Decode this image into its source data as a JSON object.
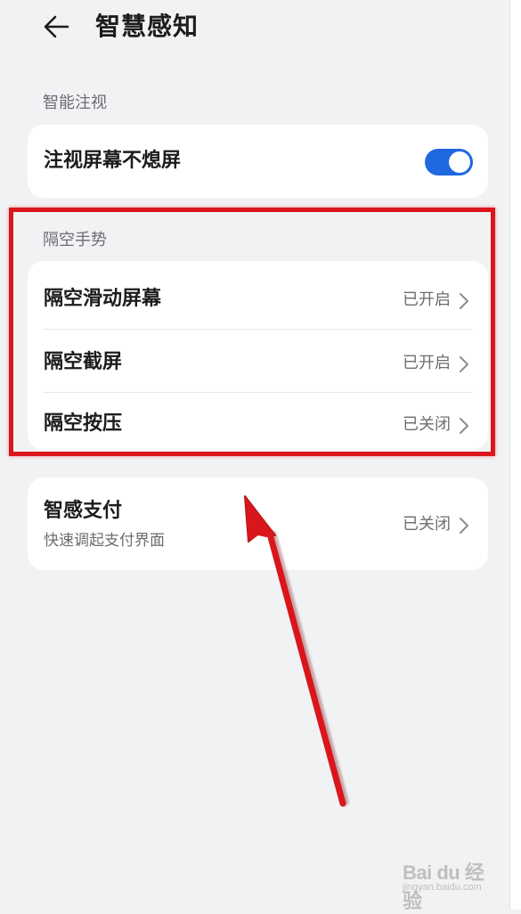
{
  "header": {
    "title": "智慧感知"
  },
  "gaze": {
    "section_label": "智能注视",
    "row": {
      "title": "注视屏幕不熄屏",
      "toggle_on": true
    }
  },
  "gesture": {
    "section_label": "隔空手势",
    "items": [
      {
        "title": "隔空滑动屏幕",
        "value": "已开启"
      },
      {
        "title": "隔空截屏",
        "value": "已开启"
      },
      {
        "title": "隔空按压",
        "value": "已关闭"
      }
    ]
  },
  "payment": {
    "title": "智感支付",
    "subtitle": "快速调起支付界面",
    "value": "已关闭"
  },
  "colors": {
    "accent": "#1f68e0",
    "annotation": "#d9161c",
    "background": "#f1f2f4"
  },
  "watermark": {
    "logo": "Bai du 经验",
    "url": "jingyan.baidu.com"
  }
}
